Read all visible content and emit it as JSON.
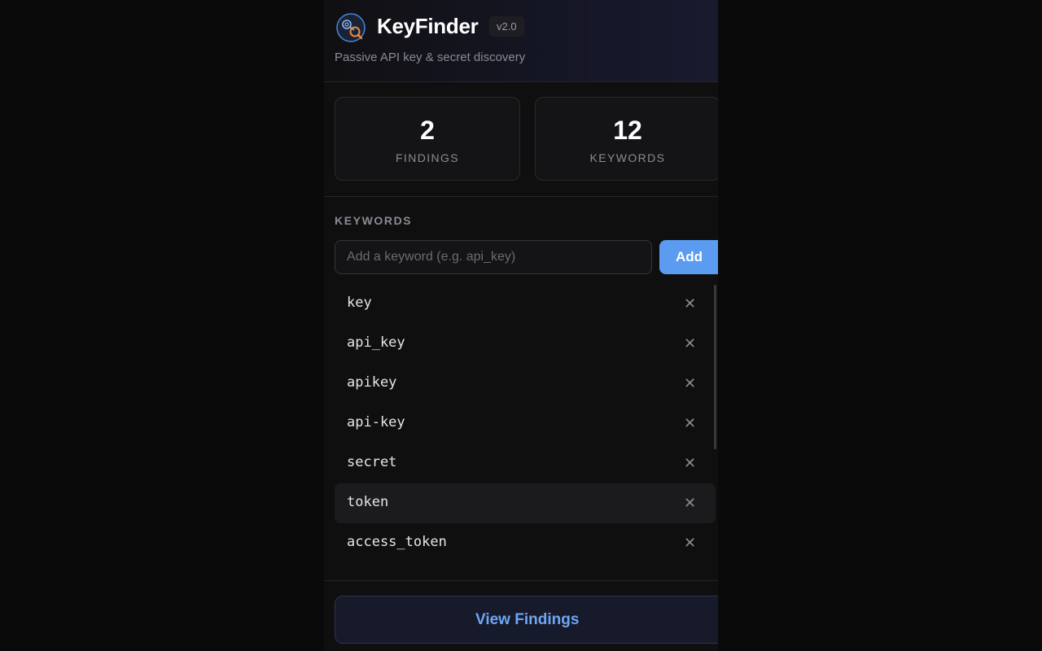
{
  "header": {
    "title": "KeyFinder",
    "version": "v2.0",
    "subtitle": "Passive API key & secret discovery",
    "logo_icon": "magnifier-keys-icon"
  },
  "stats": [
    {
      "value": "2",
      "label": "FINDINGS"
    },
    {
      "value": "12",
      "label": "KEYWORDS"
    }
  ],
  "keywords_section": {
    "title": "KEYWORDS",
    "input_placeholder": "Add a keyword (e.g. api_key)",
    "input_value": "",
    "add_label": "Add",
    "remove_glyph": "✕",
    "items": [
      {
        "label": "key"
      },
      {
        "label": "api_key"
      },
      {
        "label": "apikey"
      },
      {
        "label": "api-key"
      },
      {
        "label": "secret"
      },
      {
        "label": "token"
      },
      {
        "label": "access_token"
      }
    ]
  },
  "footer": {
    "view_findings_label": "View Findings"
  },
  "colors": {
    "accent": "#5b9bf0",
    "background": "#0f0f10",
    "card": "#141416",
    "muted_text": "#8a8a92"
  }
}
